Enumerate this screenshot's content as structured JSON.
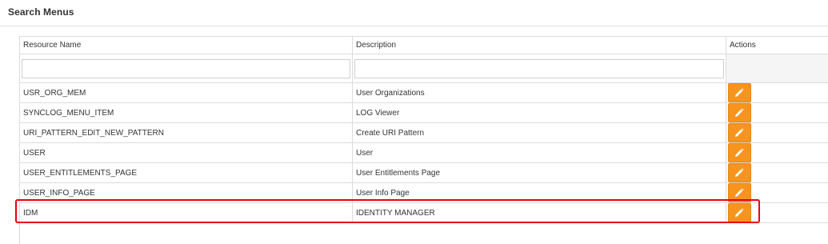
{
  "header": {
    "title": "Search Menus"
  },
  "table": {
    "columns": {
      "resource_name": "Resource Name",
      "description": "Description",
      "actions": "Actions"
    },
    "filters": {
      "resource_name": "",
      "description": ""
    },
    "rows": [
      {
        "resource_name": "USR_ORG_MEM",
        "description": "User Organizations"
      },
      {
        "resource_name": "SYNCLOG_MENU_ITEM",
        "description": "LOG Viewer"
      },
      {
        "resource_name": "URI_PATTERN_EDIT_NEW_PATTERN",
        "description": "Create URI Pattern"
      },
      {
        "resource_name": "USER",
        "description": "User"
      },
      {
        "resource_name": "USER_ENTITLEMENTS_PAGE",
        "description": "User Entitlements Page"
      },
      {
        "resource_name": "USER_INFO_PAGE",
        "description": "User Info Page"
      },
      {
        "resource_name": "IDM",
        "description": "IDENTITY MANAGER"
      }
    ],
    "row_action_icon": "pencil-icon"
  },
  "colors": {
    "edit_button": "#f7941d",
    "highlight_border": "#e8000e"
  }
}
